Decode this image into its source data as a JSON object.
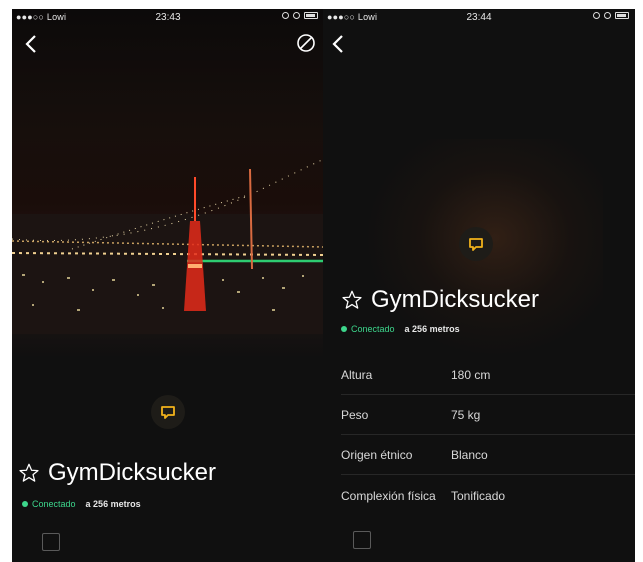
{
  "status_left": {
    "carrier": "●●●○○ Lowi",
    "time": "23:43"
  },
  "status_right": {
    "carrier": "●●●○○ Lowi",
    "time": "23:44"
  },
  "profile": {
    "name": "GymDicksucker",
    "status": "Conectado",
    "distance": "a 256 metros"
  },
  "attributes": [
    {
      "label": "Altura",
      "value": "180 cm"
    },
    {
      "label": "Peso",
      "value": "75 kg"
    },
    {
      "label": "Origen étnico",
      "value": "Blanco"
    },
    {
      "label": "Complexión física",
      "value": "Tonificado"
    }
  ],
  "colors": {
    "online": "#3dd68c",
    "chat_accent": "#f2b21b",
    "background": "#101010"
  },
  "icons": [
    "back-icon",
    "block-icon",
    "chat-icon",
    "star-icon",
    "checkbox-icon"
  ]
}
